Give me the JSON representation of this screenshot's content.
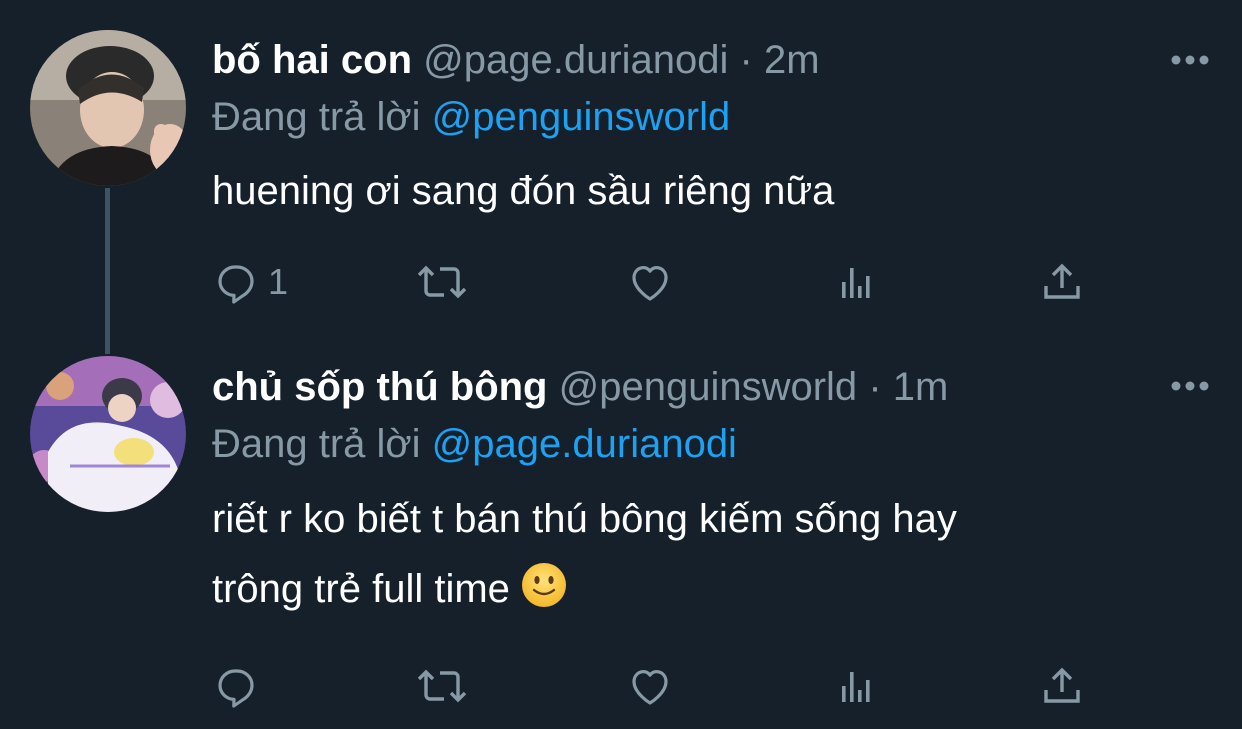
{
  "tweets": [
    {
      "display_name": "bố hai con",
      "handle": "@page.durianodi",
      "separator": "·",
      "time": "2m",
      "reply_prefix": "Đang trả lời",
      "reply_to": "@penguinsworld",
      "text": "huening ơi sang đón sầu riêng nữa",
      "reply_count": "1"
    },
    {
      "display_name": "chủ sốp thú bông",
      "handle": "@penguinsworld",
      "separator": "·",
      "time": "1m",
      "reply_prefix": "Đang trả lời",
      "reply_to": "@page.durianodi",
      "text_line1": "riết r ko biết t bán thú bông kiếm sống hay",
      "text_line2": "trông trẻ full time",
      "reply_count": ""
    }
  ],
  "colors": {
    "background": "#15202b",
    "secondary_text": "#8899a6",
    "link": "#1da1f2"
  },
  "icons": [
    "reply-icon",
    "retweet-icon",
    "like-icon",
    "analytics-icon",
    "share-icon",
    "more-options-icon",
    "slightly-smiling-face-emoji"
  ]
}
